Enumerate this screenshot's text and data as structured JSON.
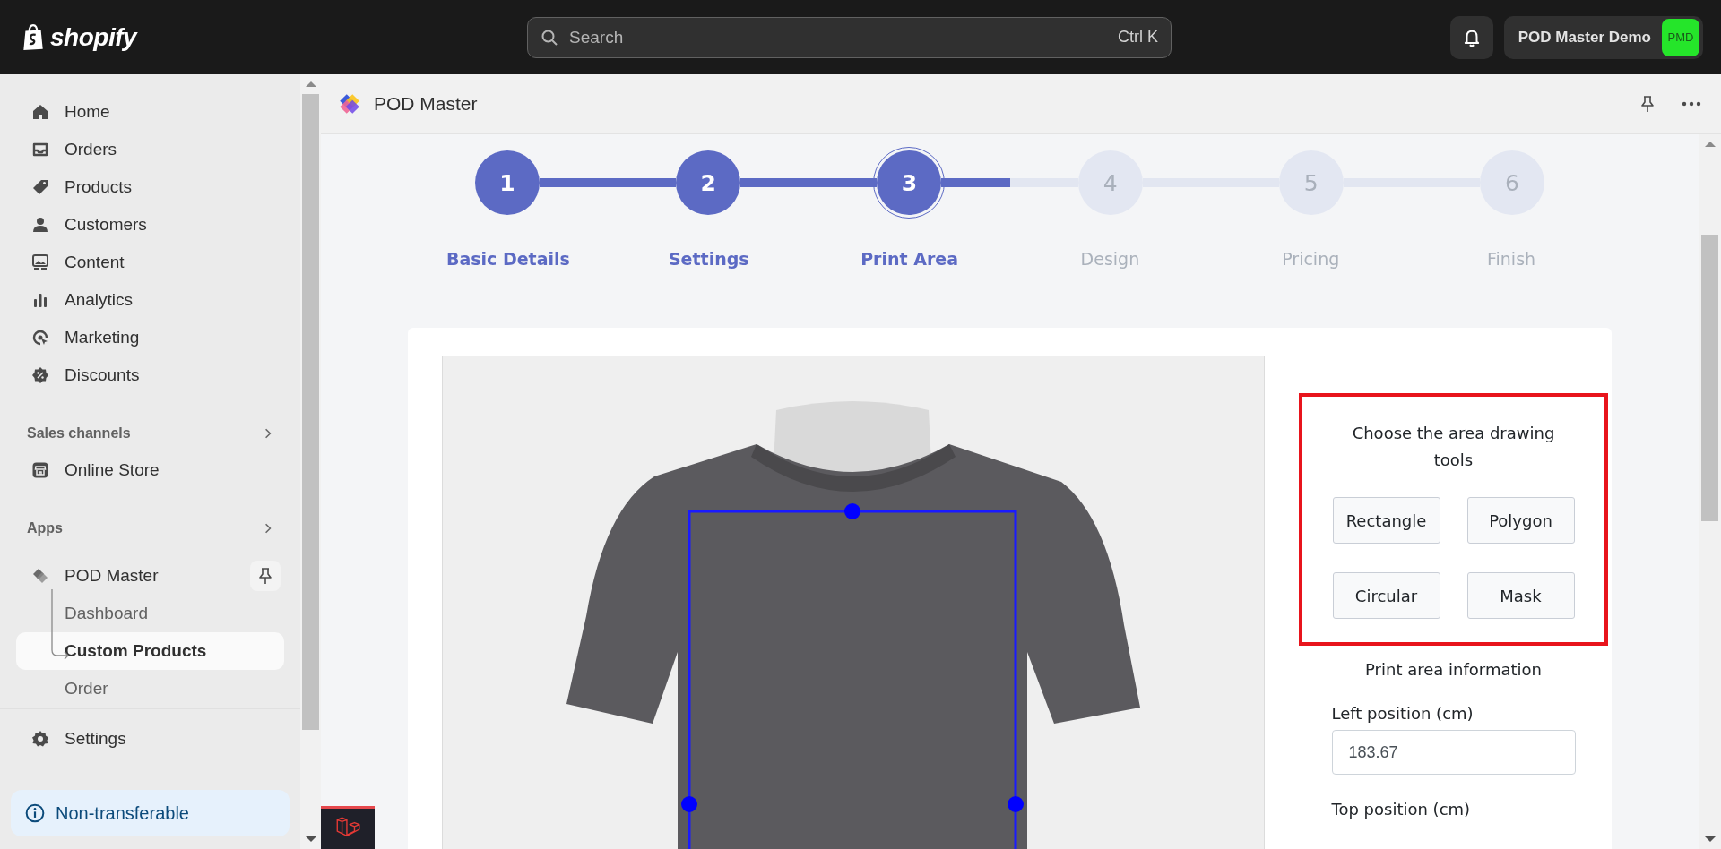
{
  "topbar": {
    "logo_text": "shopify",
    "search": {
      "placeholder": "Search",
      "shortcut": "Ctrl K"
    },
    "store": {
      "name": "POD Master Demo",
      "avatar": "PMD"
    }
  },
  "sidebar": {
    "nav": [
      {
        "label": "Home",
        "kind": "home"
      },
      {
        "label": "Orders",
        "kind": "orders"
      },
      {
        "label": "Products",
        "kind": "products"
      },
      {
        "label": "Customers",
        "kind": "customers"
      },
      {
        "label": "Content",
        "kind": "content"
      },
      {
        "label": "Analytics",
        "kind": "analytics"
      },
      {
        "label": "Marketing",
        "kind": "marketing"
      },
      {
        "label": "Discounts",
        "kind": "discounts"
      }
    ],
    "sales_channels": {
      "title": "Sales channels",
      "items": [
        {
          "label": "Online Store"
        }
      ]
    },
    "apps": {
      "title": "Apps",
      "app": {
        "label": "POD Master",
        "children": [
          {
            "label": "Dashboard",
            "selected": false
          },
          {
            "label": "Custom Products",
            "selected": true
          },
          {
            "label": "Order",
            "selected": false
          }
        ]
      }
    },
    "settings": "Settings",
    "notice": "Non-transferable"
  },
  "app_header": {
    "title": "POD Master"
  },
  "stepper": {
    "steps": [
      {
        "number": "1",
        "label": "Basic Details",
        "completed": true,
        "selected": false
      },
      {
        "number": "2",
        "label": "Settings",
        "completed": true,
        "selected": false
      },
      {
        "number": "3",
        "label": "Print Area",
        "completed": true,
        "selected": true
      },
      {
        "number": "4",
        "label": "Design",
        "completed": false,
        "selected": false
      },
      {
        "number": "5",
        "label": "Pricing",
        "completed": false,
        "selected": false
      },
      {
        "number": "6",
        "label": "Finish",
        "completed": false,
        "selected": false
      }
    ],
    "connectors": [
      {
        "completed": true
      },
      {
        "completed": true
      },
      {
        "completed": false,
        "level": 0.5
      },
      {
        "completed": false
      },
      {
        "completed": false
      }
    ]
  },
  "drawing_tools": {
    "title": "Choose the area drawing tools",
    "buttons": [
      "Rectangle",
      "Polygon",
      "Circular",
      "Mask"
    ]
  },
  "print_area": {
    "title": "Print area information",
    "fields": [
      {
        "label": "Left position (cm)",
        "value": "183.67"
      },
      {
        "label": "Top position (cm)"
      }
    ]
  }
}
